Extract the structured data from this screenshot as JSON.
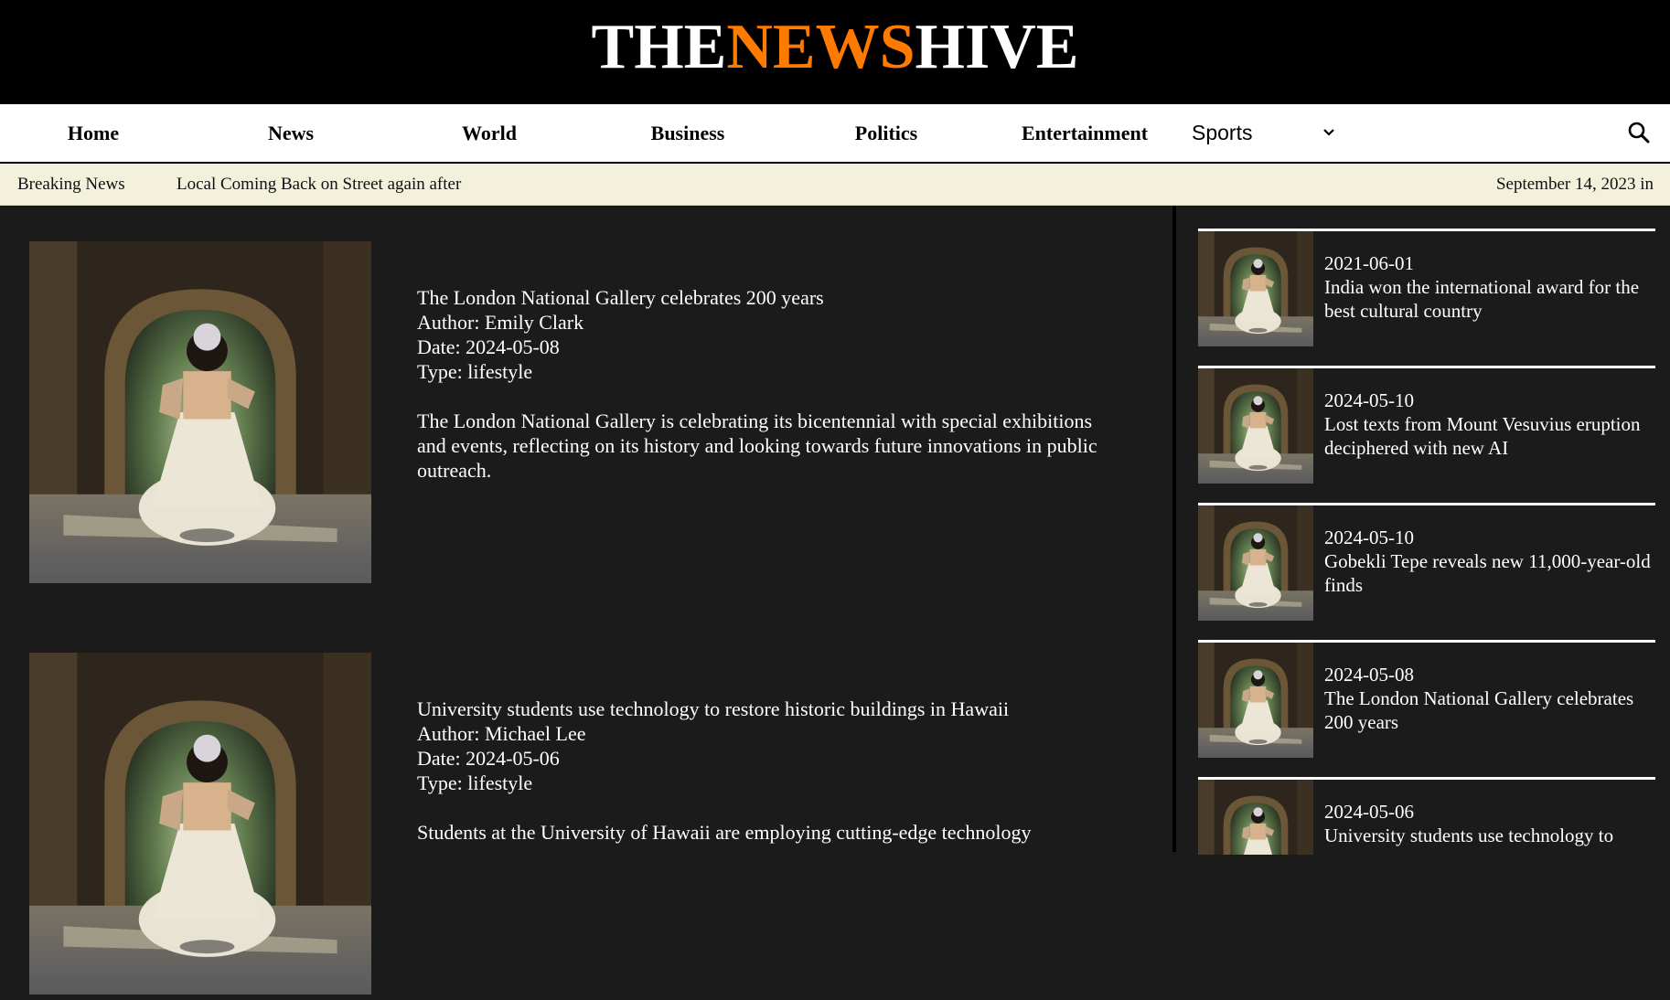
{
  "site": {
    "logo_parts": [
      "THE",
      "NEWS",
      "HIVE"
    ],
    "brand_color": "#ff7a00"
  },
  "nav": {
    "items": [
      "Home",
      "News",
      "World",
      "Business",
      "Politics",
      "Entertainment"
    ],
    "sports_select": "Sports",
    "search_icon": "search-icon",
    "chevron_icon": "chevron-down-icon"
  },
  "ticker": {
    "label": "Breaking News",
    "headline": "Local Coming Back on Street again after",
    "date": "September 14, 2023 in"
  },
  "articles": [
    {
      "title": "The London National Gallery celebrates 200 years",
      "author": "Author: Emily Clark",
      "date": "Date: 2024-05-08",
      "type": "Type: lifestyle",
      "summary": "The London National Gallery is celebrating its bicentennial with special exhibitions and events, reflecting on its history and looking towards future innovations in public outreach."
    },
    {
      "title": "University students use technology to restore historic buildings in Hawaii",
      "author": "Author: Michael Lee",
      "date": "Date: 2024-05-06",
      "type": "Type: lifestyle",
      "summary": "Students at the University of Hawaii are employing cutting-edge technology"
    }
  ],
  "sidebar": [
    {
      "date": "2021-06-01",
      "title": "India won the international award for the best cultural country"
    },
    {
      "date": "2024-05-10",
      "title": "Lost texts from Mount Vesuvius eruption deciphered with new AI"
    },
    {
      "date": "2024-05-10",
      "title": "Gobekli Tepe reveals new 11,000-year-old finds"
    },
    {
      "date": "2024-05-08",
      "title": "The London National Gallery celebrates 200 years"
    },
    {
      "date": "2024-05-06",
      "title": "University students use technology to"
    }
  ]
}
